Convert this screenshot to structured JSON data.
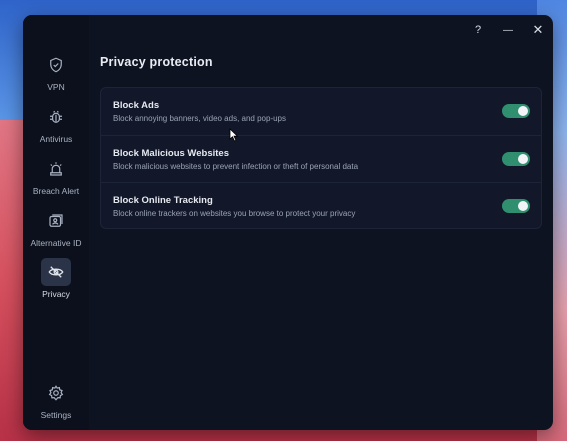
{
  "window": {
    "controls": {
      "help": "?",
      "minimize": "—",
      "close": "✕"
    }
  },
  "sidebar": {
    "items": [
      {
        "label": "VPN",
        "icon": "shield-icon",
        "active": false
      },
      {
        "label": "Antivirus",
        "icon": "bug-icon",
        "active": false
      },
      {
        "label": "Breach Alert",
        "icon": "alarm-icon",
        "active": false
      },
      {
        "label": "Alternative ID",
        "icon": "id-card-icon",
        "active": false
      },
      {
        "label": "Privacy",
        "icon": "eye-slash-icon",
        "active": true
      },
      {
        "label": "Settings",
        "icon": "gear-icon",
        "active": false
      }
    ]
  },
  "main": {
    "title": "Privacy protection",
    "settings": [
      {
        "title": "Block Ads",
        "description": "Block annoying banners, video ads, and pop-ups",
        "enabled": true
      },
      {
        "title": "Block Malicious Websites",
        "description": "Block malicious websites to prevent infection or theft of personal data",
        "enabled": true
      },
      {
        "title": "Block Online Tracking",
        "description": "Block online trackers on websites you browse to protect your privacy",
        "enabled": true
      }
    ]
  },
  "colors": {
    "window_bg": "#0e1322",
    "sidebar_bg": "#0b101c",
    "toggle_on": "#2f8f6e",
    "active_nav_bg": "#2a3347"
  }
}
